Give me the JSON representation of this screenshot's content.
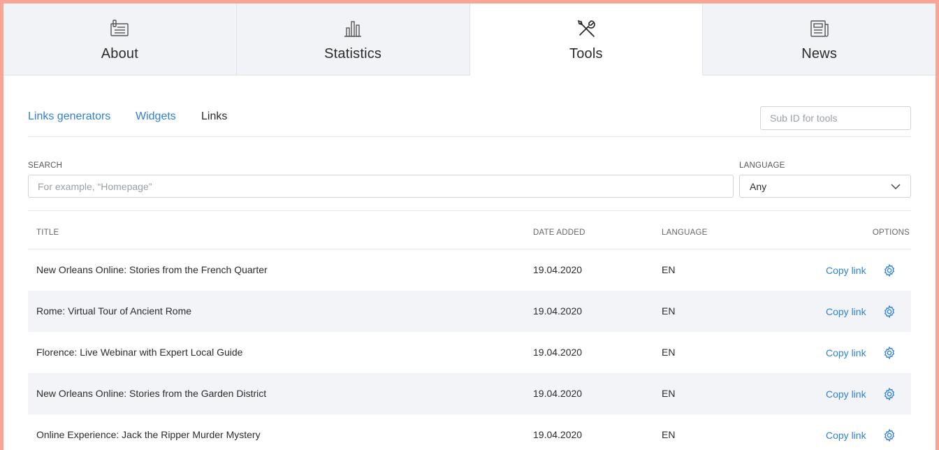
{
  "tabs": [
    {
      "label": "About",
      "icon": "document-icon"
    },
    {
      "label": "Statistics",
      "icon": "bar-chart-icon"
    },
    {
      "label": "Tools",
      "icon": "tools-icon"
    },
    {
      "label": "News",
      "icon": "newspaper-icon"
    }
  ],
  "active_tab": "Tools",
  "subnav": {
    "items": [
      {
        "label": "Links generators"
      },
      {
        "label": "Widgets"
      },
      {
        "label": "Links"
      }
    ],
    "subid_placeholder": "Sub ID for tools"
  },
  "filters": {
    "search_label": "SEARCH",
    "search_placeholder": "For example, “Homepage”",
    "language_label": "LANGUAGE",
    "language_value": "Any"
  },
  "table": {
    "headers": {
      "title": "TITLE",
      "date_added": "DATE ADDED",
      "language": "LANGUAGE",
      "options": "OPTIONS"
    },
    "rows": [
      {
        "title": "New Orleans Online: Stories from the French Quarter",
        "date": "19.04.2020",
        "language": "EN",
        "action": "Copy link"
      },
      {
        "title": "Rome: Virtual Tour of Ancient Rome",
        "date": "19.04.2020",
        "language": "EN",
        "action": "Copy link"
      },
      {
        "title": "Florence: Live Webinar with Expert Local Guide",
        "date": "19.04.2020",
        "language": "EN",
        "action": "Copy link"
      },
      {
        "title": "New Orleans Online: Stories from the Garden District",
        "date": "19.04.2020",
        "language": "EN",
        "action": "Copy link"
      },
      {
        "title": "Online Experience: Jack the Ripper Murder Mystery",
        "date": "19.04.2020",
        "language": "EN",
        "action": "Copy link"
      }
    ]
  },
  "colors": {
    "accent": "#2f80d6",
    "page_border": "#f6a596",
    "tab_inactive": "#f2f3f7",
    "row_alt": "#f3f4f8"
  }
}
